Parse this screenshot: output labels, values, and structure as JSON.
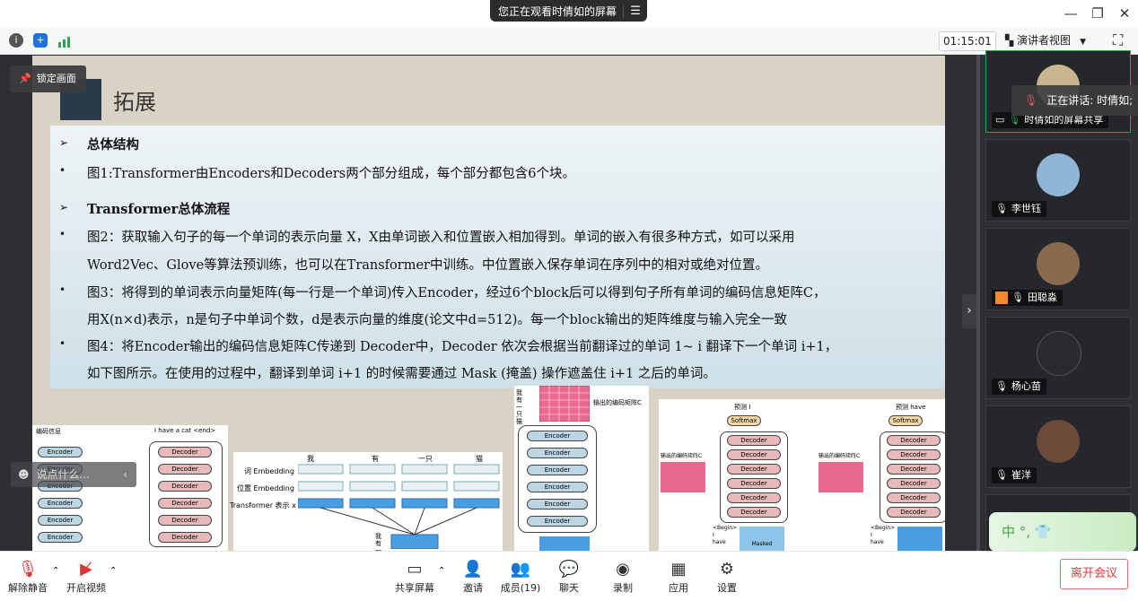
{
  "banner": {
    "text": "您正在观看时倩如的屏幕",
    "menu_icon": "menu-icon"
  },
  "window": {
    "minimize": "—",
    "restore": "❐",
    "close": "✕"
  },
  "toolbar": {
    "timer": "01:15:01",
    "view_mode": "演讲者视图"
  },
  "overlays": {
    "lock_screen": "锁定画面",
    "chat_placeholder": "说点什么...",
    "speaking": "正在讲话: 时倩如;"
  },
  "slide": {
    "title": "拓展",
    "sections": [
      {
        "heading": "总体结构"
      },
      {
        "heading": "Transformer总体流程"
      }
    ],
    "bullets": {
      "b1": "图1:Transformer由Encoders和Decoders两个部分组成，每个部分都包含6个块。",
      "b2a": "图2：获取输入句子的每一个单词的表示向量 X，X由单词嵌入和位置嵌入相加得到。单词的嵌入有很多种方式，如可以采用",
      "b2b": "Word2Vec、Glove等算法预训练，也可以在Transformer中训练。中位置嵌入保存单词在序列中的相对或绝对位置。",
      "b3a": "图3：将得到的单词表示向量矩阵(每一行是一个单词)传入Encoder，经过6个block后可以得到句子所有单词的编码信息矩阵C，",
      "b3b": "用X(n×d)表示，n是句子中单词个数，d是表示向量的维度(论文中d=512)。每一个block输出的矩阵维度与输入完全一致",
      "b4a": "图4：将Encoder输出的编码信息矩阵C传递到 Decoder中，Decoder 依次会根据当前翻译过的单词 1~ i 翻译下一个单词 i+1，",
      "b4b": "如下图所示。在使用的过程中，翻译到单词 i+1 的时候需要通过 Mask (掩盖) 操作遮盖住 i+1 之后的单词。"
    },
    "fig1": {
      "enc_label": "编码信息",
      "dec_label": "I  have  a  cat  <end>",
      "encoder": "Encoder",
      "decoder": "Decoder"
    },
    "fig2": {
      "words": [
        "我",
        "有",
        "一只",
        "猫"
      ],
      "row1": "词 Embedding",
      "row2": "位置 Embedding",
      "row3": "Transformer 表示 x",
      "out": "我有一只猫"
    },
    "fig3": {
      "words": "我有一只猫",
      "matrix_label": "输出的编码矩阵C",
      "encoder": "Encoder"
    },
    "fig4": {
      "pred1": "预测 I",
      "pred2": "预测 have",
      "softmax": "Softmax",
      "decoder": "Decoder",
      "enc_matrix": "输出的编码矩阵C",
      "begin1": "<Begin>\nI\nhave",
      "masked": "Masked"
    }
  },
  "participants": [
    {
      "name": "时倩如的屏幕共享",
      "avatar_color": "#c9b58f"
    },
    {
      "name": "李世钰",
      "avatar_color": "#8fb6d6"
    },
    {
      "name": "田聪淼",
      "avatar_color": "#8a6a4e"
    },
    {
      "name": "杨心苗",
      "avatar_color": "#2a2a30"
    },
    {
      "name": "崔洋",
      "avatar_color": "#6b4a3a"
    }
  ],
  "bottom": {
    "unmute": "解除静音",
    "video": "开启视频",
    "share": "共享屏幕",
    "invite": "邀请",
    "members": "成员(19)",
    "chat": "聊天",
    "record": "录制",
    "apps": "应用",
    "settings": "设置",
    "leave": "离开会议"
  },
  "input_widget": "中 °, 👕"
}
